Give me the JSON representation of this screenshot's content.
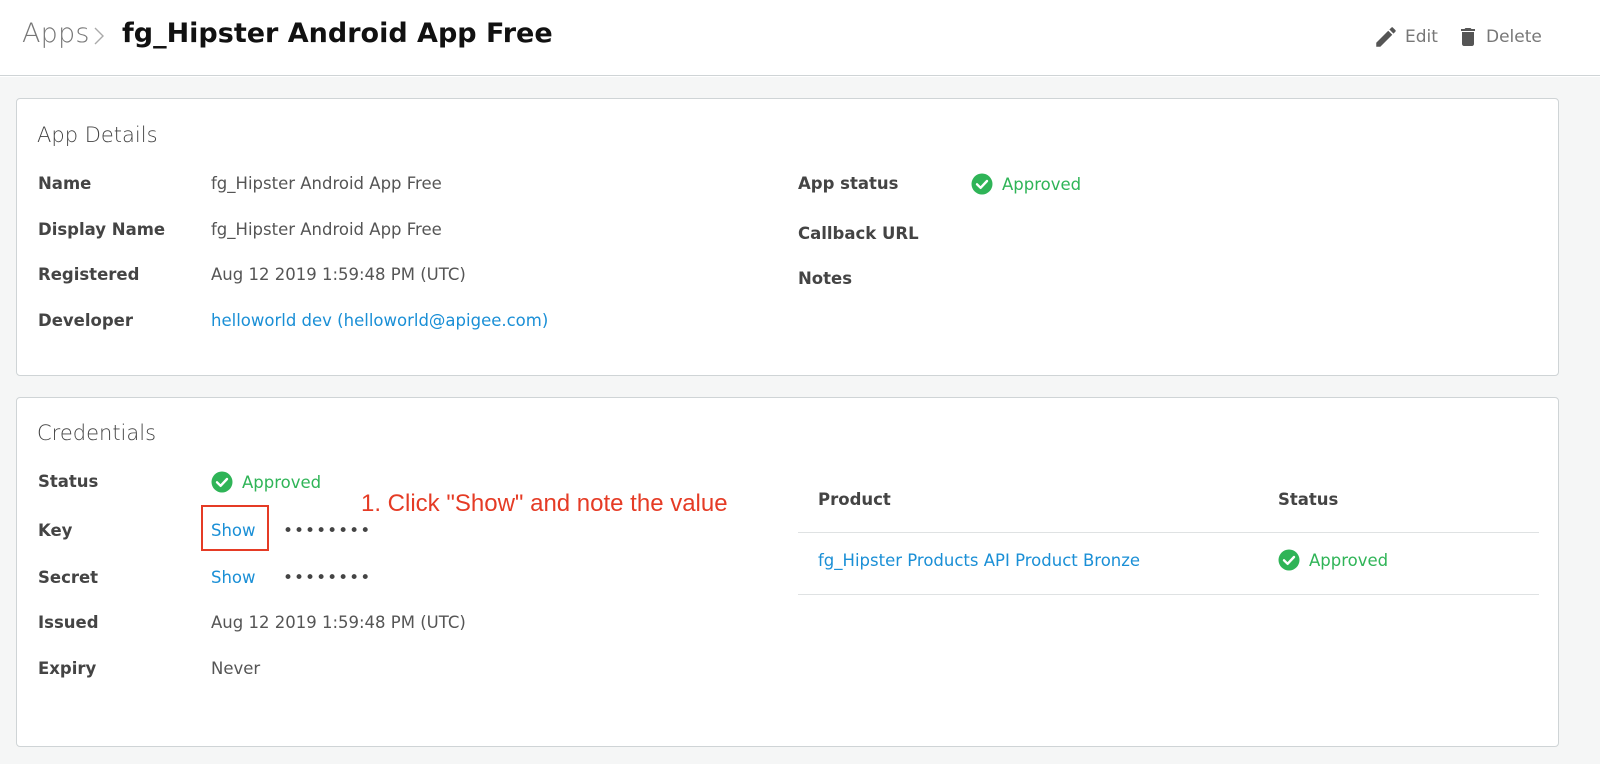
{
  "header": {
    "breadcrumb": "Apps",
    "title": "fg_Hipster Android App Free",
    "edit_label": "Edit",
    "delete_label": "Delete"
  },
  "app_details": {
    "title": "App Details",
    "fields": {
      "name_label": "Name",
      "name_value": "fg_Hipster Android App Free",
      "display_name_label": "Display Name",
      "display_name_value": "fg_Hipster Android App Free",
      "registered_label": "Registered",
      "registered_value": "Aug 12 2019 1:59:48 PM (UTC)",
      "developer_label": "Developer",
      "developer_value": "helloworld dev (helloworld@apigee.com)"
    },
    "right": {
      "app_status_label": "App status",
      "app_status_value": "Approved",
      "callback_label": "Callback URL",
      "notes_label": "Notes"
    }
  },
  "credentials": {
    "title": "Credentials",
    "status_label": "Status",
    "status_value": "Approved",
    "key_label": "Key",
    "key_show": "Show",
    "key_masked": "••••••••",
    "secret_label": "Secret",
    "secret_show": "Show",
    "secret_masked": "••••••••",
    "issued_label": "Issued",
    "issued_value": "Aug 12 2019 1:59:48 PM (UTC)",
    "expiry_label": "Expiry",
    "expiry_value": "Never",
    "products_table": {
      "headers": [
        "Product",
        "Status"
      ],
      "rows": [
        {
          "product": "fg_Hipster Products API Product Bronze",
          "status": "Approved"
        }
      ]
    }
  },
  "annotation": {
    "text": "1. Click \"Show\" and note the value"
  },
  "colors": {
    "approved": "#2fb457",
    "link": "#1a8fd6",
    "annotation": "#e53b25"
  },
  "icons": [
    "chevron-right-icon",
    "pencil-icon",
    "trash-icon",
    "check-circle-icon"
  ]
}
